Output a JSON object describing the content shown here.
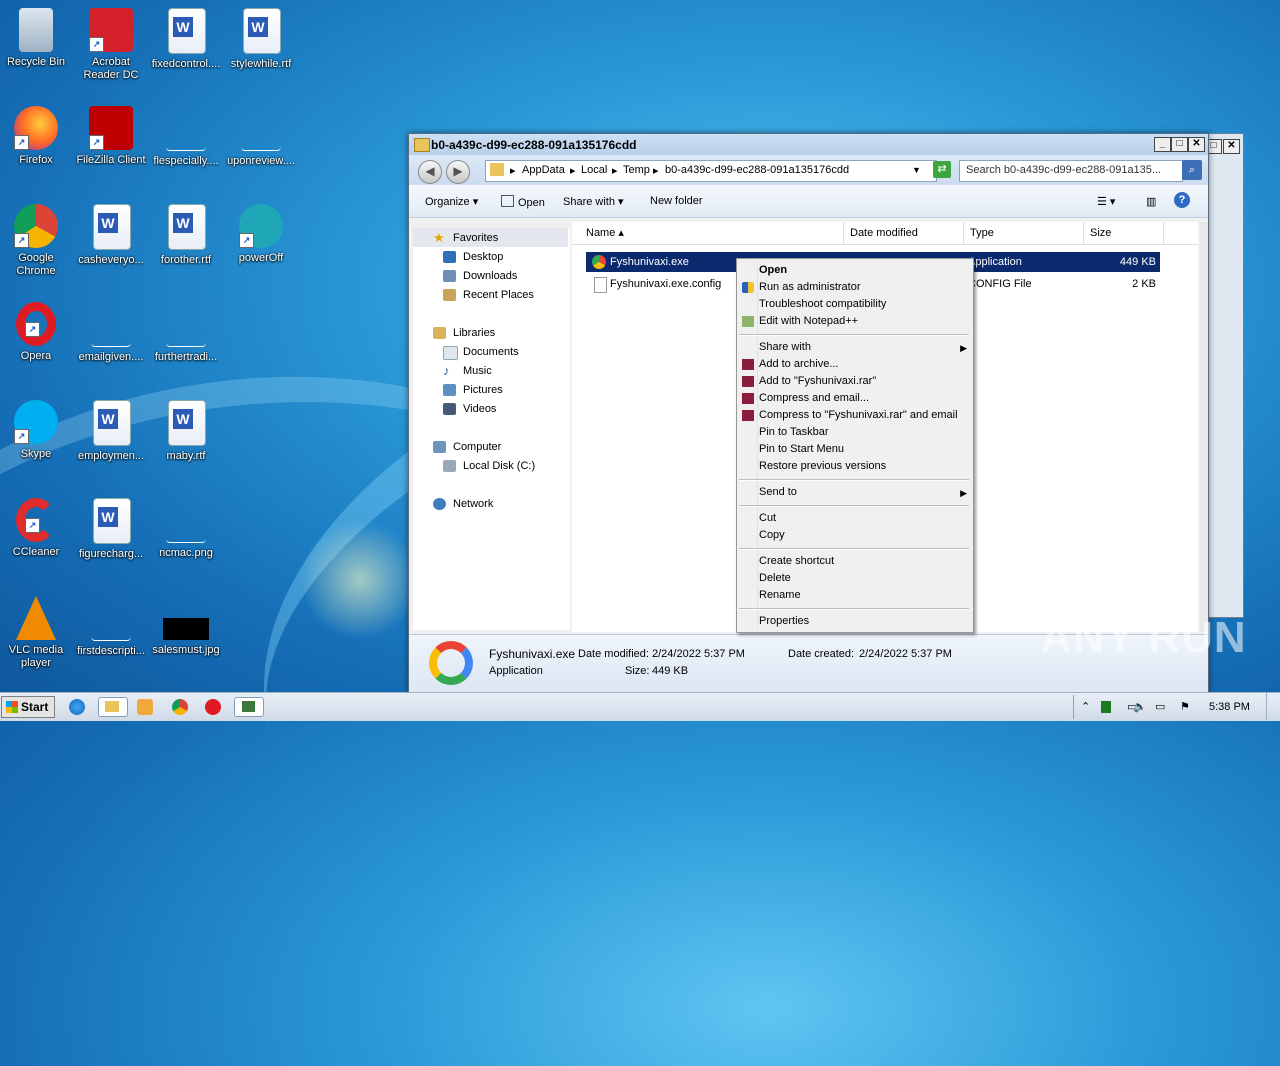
{
  "desktop_icons": [
    {
      "label": "Recycle Bin"
    },
    {
      "label": "Acrobat Reader DC"
    },
    {
      "label": "fixedcontrol...."
    },
    {
      "label": "stylewhile.rtf"
    },
    {
      "label": "Firefox"
    },
    {
      "label": "FileZilla Client"
    },
    {
      "label": "flespecially...."
    },
    {
      "label": "uponreview...."
    },
    {
      "label": "Google Chrome"
    },
    {
      "label": "casheveryo..."
    },
    {
      "label": "forother.rtf"
    },
    {
      "label": "powerOff"
    },
    {
      "label": "Opera"
    },
    {
      "label": "emailgiven...."
    },
    {
      "label": "furthertradi..."
    },
    {
      "label": "Skype"
    },
    {
      "label": "employmen..."
    },
    {
      "label": "maby.rtf"
    },
    {
      "label": "CCleaner"
    },
    {
      "label": "figurecharg..."
    },
    {
      "label": "ncmac.png"
    },
    {
      "label": "VLC media player"
    },
    {
      "label": "firstdescripti..."
    },
    {
      "label": "salesmust.jpg"
    }
  ],
  "window": {
    "title": "b0-a439c-d99-ec288-091a135176cdd",
    "breadcrumb": [
      "AppData",
      "Local",
      "Temp",
      "b0-a439c-d99-ec288-091a135176cdd"
    ],
    "search_placeholder": "Search b0-a439c-d99-ec288-091a135...",
    "toolbar": {
      "organize": "Organize",
      "open": "Open",
      "share_with": "Share with",
      "new_folder": "New folder"
    },
    "nav": {
      "favorites": "Favorites",
      "desktop": "Desktop",
      "downloads": "Downloads",
      "recent_places": "Recent Places",
      "libraries": "Libraries",
      "documents": "Documents",
      "music": "Music",
      "pictures": "Pictures",
      "videos": "Videos",
      "computer": "Computer",
      "local_disk": "Local Disk (C:)",
      "network": "Network"
    },
    "columns": {
      "name": "Name",
      "date_modified": "Date modified",
      "type": "Type",
      "size": "Size"
    },
    "files": [
      {
        "name": "Fyshunivaxi.exe",
        "type": "Application",
        "size": "449 KB"
      },
      {
        "name": "Fyshunivaxi.exe.config",
        "type": "CONFIG File",
        "size": "2 KB"
      }
    ],
    "details": {
      "file_name": "Fyshunivaxi.exe",
      "file_type": "Application",
      "date_modified_label": "Date modified:",
      "date_modified": "2/24/2022 5:37 PM",
      "size_label": "Size:",
      "size": "449 KB",
      "date_created_label": "Date created:",
      "date_created": "2/24/2022 5:37 PM"
    }
  },
  "context_menu": {
    "open": "Open",
    "run_as_admin": "Run as administrator",
    "troubleshoot": "Troubleshoot compatibility",
    "edit_notepad": "Edit with Notepad++",
    "share_with": "Share with",
    "add_archive": "Add to archive...",
    "add_rar": "Add to \"Fyshunivaxi.rar\"",
    "compress_email": "Compress and email...",
    "compress_rar_email": "Compress to \"Fyshunivaxi.rar\" and email",
    "pin_taskbar": "Pin to Taskbar",
    "pin_start": "Pin to Start Menu",
    "restore": "Restore previous versions",
    "send_to": "Send to",
    "cut": "Cut",
    "copy": "Copy",
    "create_shortcut": "Create shortcut",
    "delete": "Delete",
    "rename": "Rename",
    "properties": "Properties"
  },
  "watermark": "ANY RUN",
  "taskbar": {
    "start": "Start",
    "clock": "5:38 PM"
  }
}
